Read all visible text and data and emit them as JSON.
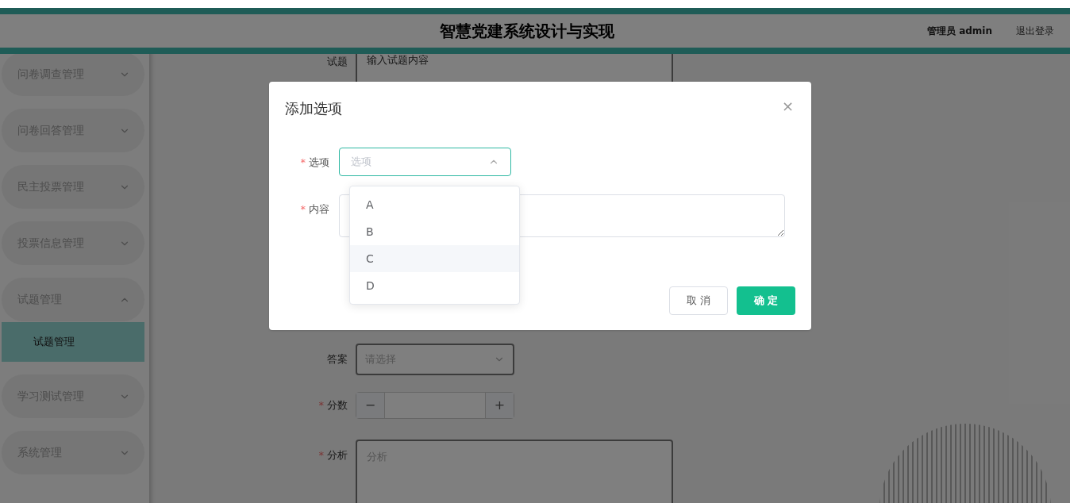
{
  "header": {
    "title": "智慧党建系统设计与实现",
    "user": "管理员 admin",
    "logout": "退出登录"
  },
  "sidebar": {
    "items": [
      {
        "label": "问卷调查管理",
        "expanded": false
      },
      {
        "label": "问卷回答管理",
        "expanded": false
      },
      {
        "label": "民主投票管理",
        "expanded": false
      },
      {
        "label": "投票信息管理",
        "expanded": false
      },
      {
        "label": "试题管理",
        "expanded": true,
        "children": [
          {
            "label": "试题管理",
            "selected": true
          }
        ]
      },
      {
        "label": "学习测试管理",
        "expanded": false
      },
      {
        "label": "系统管理",
        "expanded": false
      }
    ]
  },
  "form": {
    "question": {
      "label": "试题",
      "value": "输入试题内容"
    },
    "answer": {
      "label": "答案",
      "placeholder": "请选择"
    },
    "score": {
      "label": "分数",
      "required_mark": "*",
      "minus": "−",
      "plus": "+"
    },
    "analysis": {
      "label": "分析",
      "required_mark": "*",
      "placeholder": "分析"
    }
  },
  "dialog": {
    "title": "添加选项",
    "close": "×",
    "fields": [
      {
        "kind": "select",
        "label": "选项",
        "required_mark": "*",
        "placeholder": "选项",
        "expanded": true
      },
      {
        "kind": "textarea",
        "label": "内容",
        "required_mark": "*"
      }
    ],
    "dropdown": [
      {
        "label": "A",
        "highlighted": false
      },
      {
        "label": "B",
        "highlighted": false
      },
      {
        "label": "C",
        "highlighted": true
      },
      {
        "label": "D",
        "highlighted": false
      }
    ],
    "buttons": [
      {
        "label": "取 消",
        "kind": "secondary"
      },
      {
        "label": "确 定",
        "kind": "primary"
      }
    ]
  }
}
